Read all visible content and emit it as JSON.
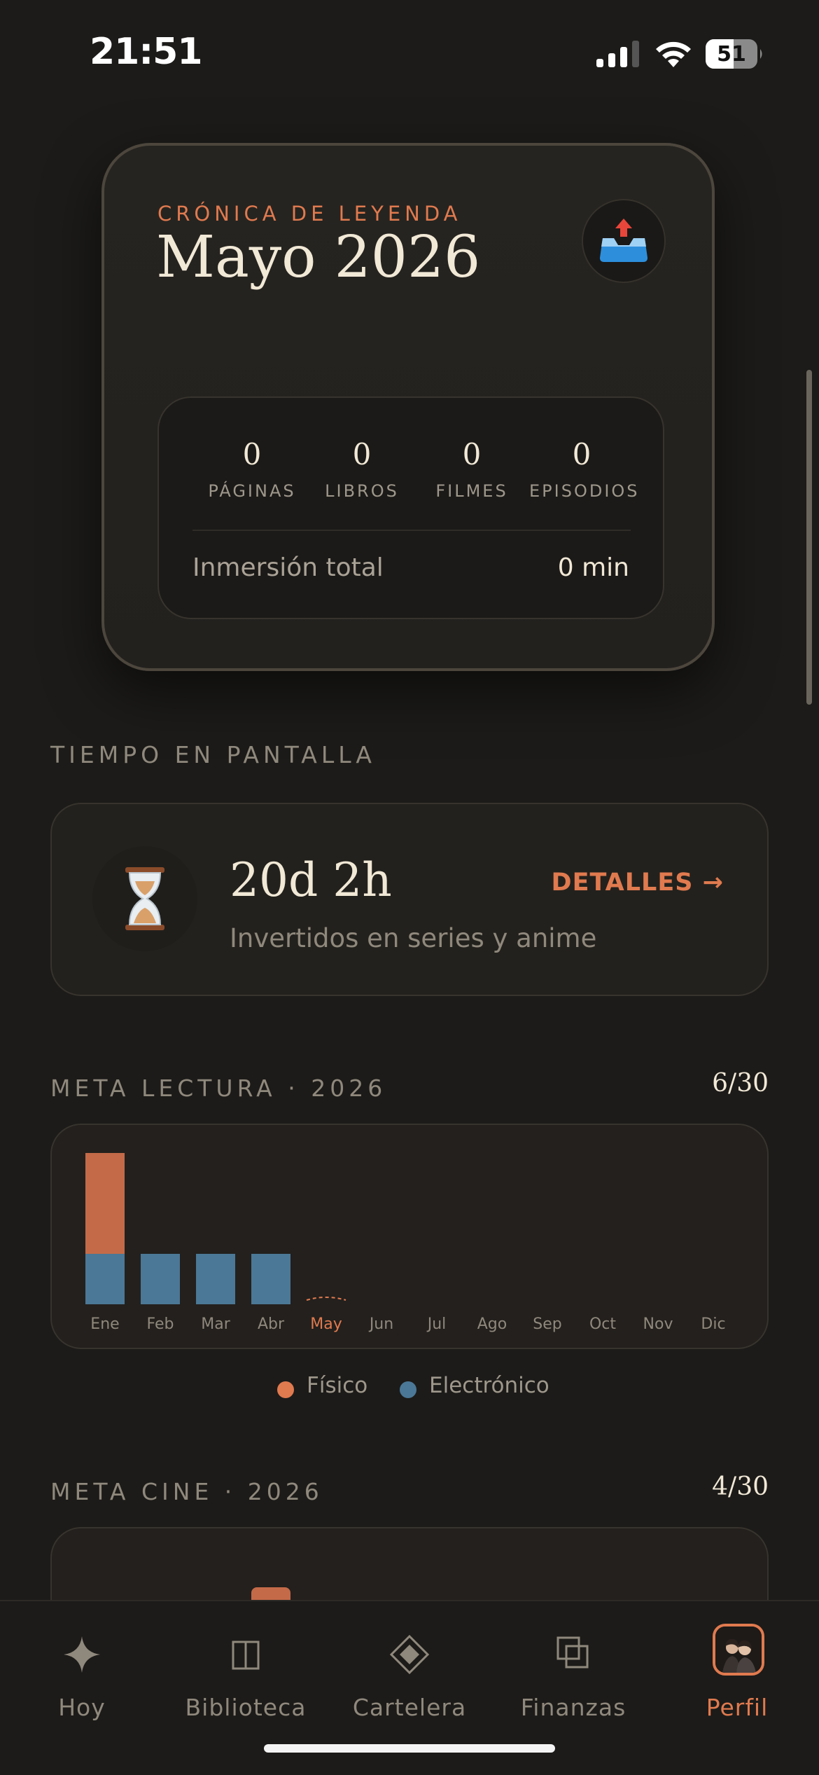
{
  "status_bar": {
    "time": "21:51",
    "battery": "51"
  },
  "hero": {
    "kicker": "CRÓNICA DE LEYENDA",
    "title": "Mayo 2026",
    "share_icon": "outbox-tray-icon",
    "stats": [
      {
        "value": "0",
        "label": "PÁGINAS"
      },
      {
        "value": "0",
        "label": "LIBROS"
      },
      {
        "value": "0",
        "label": "FILMES"
      },
      {
        "value": "0",
        "label": "EPISODIOS"
      }
    ],
    "immersion_label": "Inmersión total",
    "immersion_value": "0 min"
  },
  "screen_time": {
    "section_title": "TIEMPO EN PANTALLA",
    "icon": "hourglass-icon",
    "value": "20d 2h",
    "subtitle": "Invertidos en series y anime",
    "link": "DETALLES →"
  },
  "reading_goal": {
    "section_title": "META LECTURA · 2026",
    "count": "6/30",
    "current_month": "May",
    "legend": [
      {
        "name": "Físico",
        "color": "#e07a4f"
      },
      {
        "name": "Electrónico",
        "color": "#4b7896"
      }
    ]
  },
  "cinema_goal": {
    "section_title": "META CINE · 2026",
    "count": "4/30"
  },
  "chart_data": {
    "type": "bar",
    "stacked": true,
    "categories": [
      "Ene",
      "Feb",
      "Mar",
      "Abr",
      "May",
      "Jun",
      "Jul",
      "Ago",
      "Sep",
      "Oct",
      "Nov",
      "Dic"
    ],
    "series": [
      {
        "name": "Electrónico",
        "color": "#4b7896",
        "values": [
          1,
          1,
          1,
          1,
          0,
          0,
          0,
          0,
          0,
          0,
          0,
          0
        ]
      },
      {
        "name": "Físico",
        "color": "#c46a48",
        "values": [
          2,
          0,
          0,
          0,
          0,
          0,
          0,
          0,
          0,
          0,
          0,
          0
        ]
      }
    ],
    "ylim": [
      0,
      3
    ]
  },
  "tabbar": {
    "items": [
      {
        "label": "Hoy",
        "icon": "sparkle-icon"
      },
      {
        "label": "Biblioteca",
        "icon": "book-icon"
      },
      {
        "label": "Cartelera",
        "icon": "diamond-icon"
      },
      {
        "label": "Finanzas",
        "icon": "layers-icon"
      },
      {
        "label": "Perfil",
        "icon": "avatar-icon"
      }
    ],
    "active": "Perfil"
  }
}
